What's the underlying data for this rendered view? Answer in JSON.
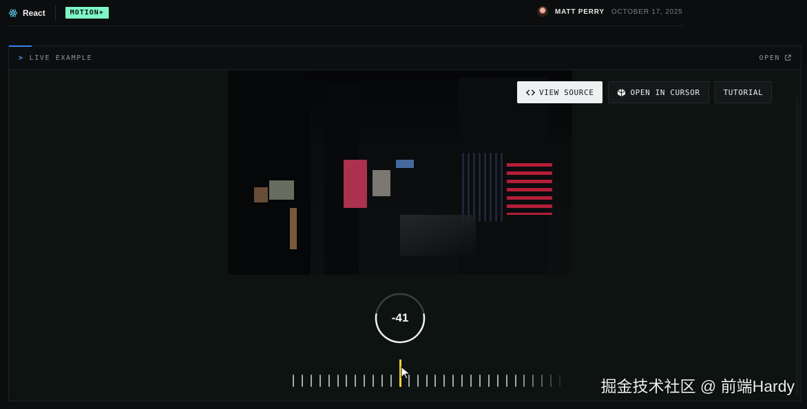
{
  "header": {
    "framework": "React",
    "badge": "MOTION+",
    "author": "MATT PERRY",
    "date": "OCTOBER 17, 2025"
  },
  "panel": {
    "live_label": "LIVE EXAMPLE",
    "open_label": "OPEN"
  },
  "actions": {
    "view_source": "VIEW SOURCE",
    "open_in_cursor": "OPEN IN CURSOR",
    "tutorial": "TUTORIAL"
  },
  "dial": {
    "value": "-41",
    "arc_fraction": 0.55
  },
  "ruler": {
    "tick_count": 31,
    "current_index": 12
  },
  "watermark": "掘金技术社区 @ 前端Hardy",
  "colors": {
    "accent": "#7ff5c6",
    "tab_indicator": "#3b82f6",
    "current_tick": "#f2cf3c"
  }
}
